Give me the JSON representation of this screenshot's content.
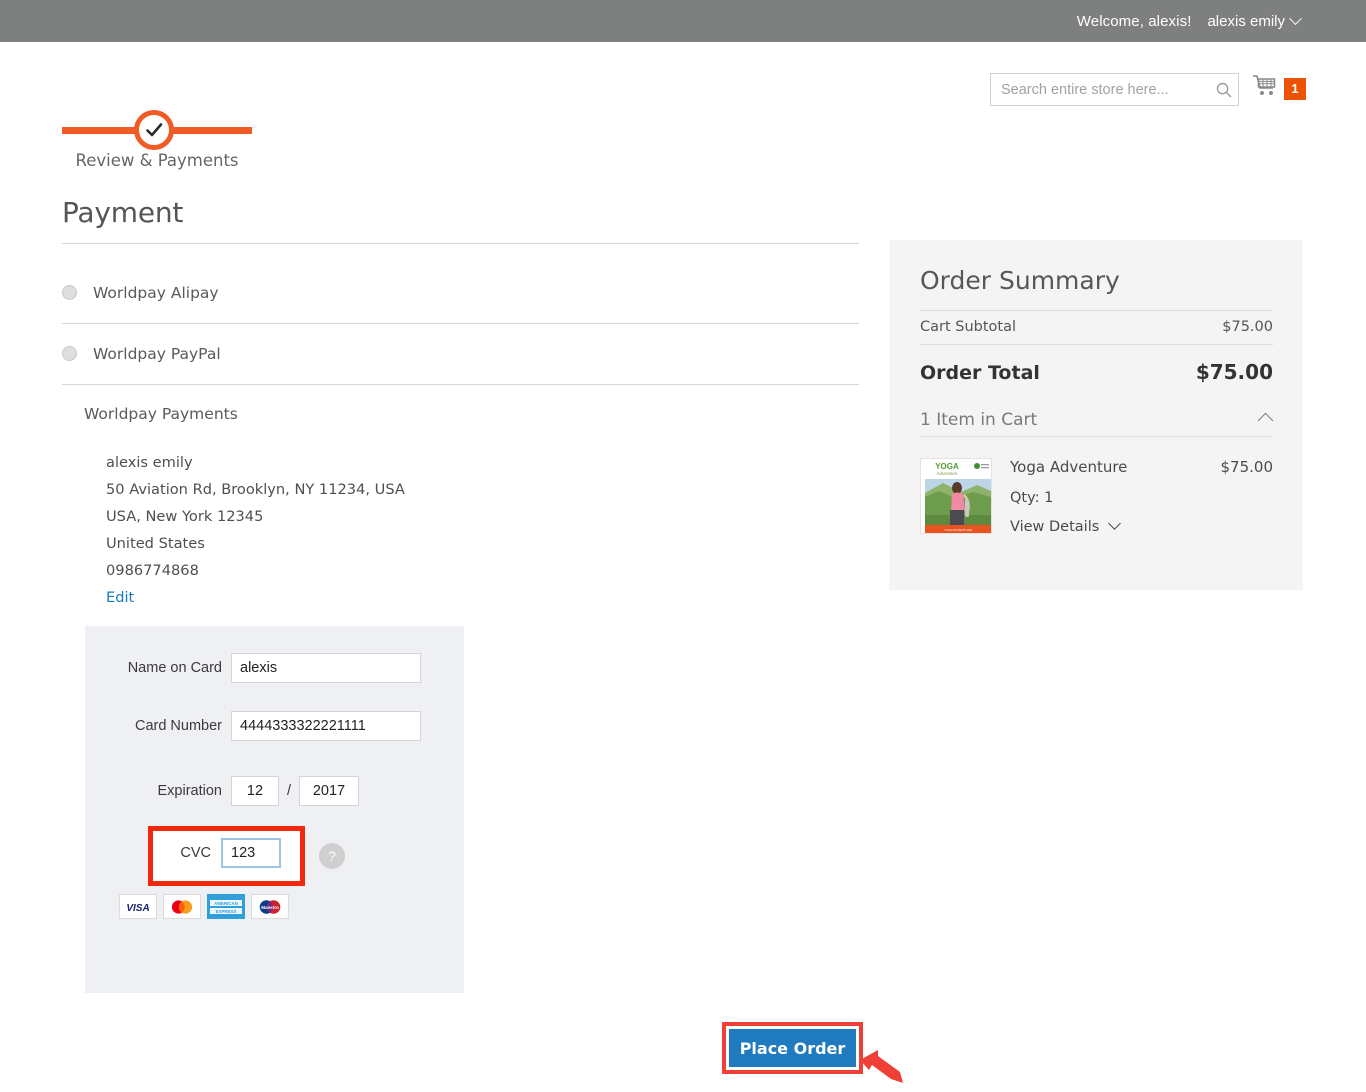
{
  "topbar": {
    "welcome": "Welcome, alexis!",
    "account_label": "alexis emily",
    "bg_color": "#7d807e"
  },
  "search": {
    "placeholder": "Search entire store here...",
    "value": "",
    "icon": "search-icon"
  },
  "cart": {
    "icon": "shopping-cart-icon",
    "count": "1",
    "badge_color": "#eb5202"
  },
  "progress": {
    "step_label": "Review & Payments",
    "completed": true,
    "accent_color": "#f05a24",
    "icon": "check-icon"
  },
  "payment": {
    "heading": "Payment",
    "methods": [
      {
        "label": "Worldpay Alipay",
        "selected": false
      },
      {
        "label": "Worldpay PayPal",
        "selected": false
      }
    ],
    "selected_method_label": "Worldpay Payments",
    "billing_address": {
      "name": "alexis emily",
      "line1": "50 Aviation Rd, Brooklyn, NY 11234, USA",
      "line2": "USA, New York 12345",
      "country": "United States",
      "phone": "0986774868",
      "edit_label": "Edit",
      "edit_color": "#1979c3"
    },
    "form": {
      "name_on_card": {
        "label": "Name on Card",
        "value": "alexis"
      },
      "card_number": {
        "label": "Card Number",
        "value": "4444333322221111"
      },
      "expiration": {
        "label": "Expiration",
        "month": "12",
        "separator": "/",
        "year": "2017"
      },
      "cvc": {
        "label": "CVC",
        "value": "123",
        "focused": true,
        "help_icon": "question-mark-icon"
      },
      "accepted_cards": [
        "VISA",
        "Mastercard",
        "American Express",
        "Maestro"
      ]
    }
  },
  "order_summary": {
    "title": "Order Summary",
    "cart_subtotal_label": "Cart Subtotal",
    "cart_subtotal_value": "$75.00",
    "order_total_label": "Order Total",
    "order_total_value": "$75.00",
    "items_in_cart_label": "1 Item in Cart",
    "expanded": true,
    "item": {
      "name": "Yoga Adventure",
      "price": "$75.00",
      "qty_label": "Qty: 1",
      "view_details_label": "View Details",
      "thumb_title": "YOGA",
      "thumb_subtitle": "Adventure"
    }
  },
  "footer": {
    "place_order_label": "Place Order",
    "place_order_color": "#1f7ac0",
    "annotation_color": "#ee4036"
  }
}
